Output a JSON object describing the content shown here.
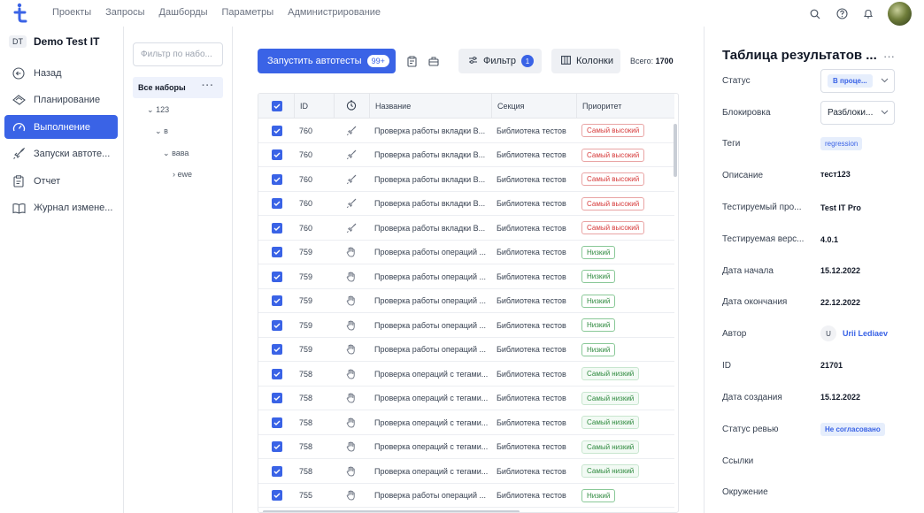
{
  "topnav": [
    "Проекты",
    "Запросы",
    "Дашборды",
    "Параметры",
    "Администрирование"
  ],
  "project": {
    "abbr": "DT",
    "name": "Demo Test IT"
  },
  "sidebar": [
    {
      "label": "Назад",
      "icon": "back-icon"
    },
    {
      "label": "Планирование",
      "icon": "planning-icon"
    },
    {
      "label": "Выполнение",
      "icon": "speedometer-icon",
      "active": true
    },
    {
      "label": "Запуски автоте...",
      "icon": "rocket-icon"
    },
    {
      "label": "Отчет",
      "icon": "report-icon"
    },
    {
      "label": "Журнал измене...",
      "icon": "book-icon"
    }
  ],
  "tree": {
    "filter_placeholder": "Фильтр по набо...",
    "all": "Все наборы",
    "nodes": [
      "123",
      "в",
      "вава",
      "ewe"
    ]
  },
  "toolbar": {
    "run_label": "Запустить автотесты",
    "run_badge": "99+",
    "filter_label": "Фильтр",
    "filter_count": "1",
    "columns_label": "Колонки",
    "total_label": "Всего:",
    "total_value": "1700"
  },
  "table": {
    "headers": {
      "id": "ID",
      "name": "Название",
      "section": "Секция",
      "priority": "Приоритет"
    },
    "rows": [
      {
        "id": "760",
        "type": "auto",
        "name": "Проверка работы вкладки В...",
        "section": "Библиотека тестов",
        "priority": "Самый высокий",
        "level": "high"
      },
      {
        "id": "760",
        "type": "auto",
        "name": "Проверка работы вкладки В...",
        "section": "Библиотека тестов",
        "priority": "Самый высокий",
        "level": "high"
      },
      {
        "id": "760",
        "type": "auto",
        "name": "Проверка работы вкладки В...",
        "section": "Библиотека тестов",
        "priority": "Самый высокий",
        "level": "high"
      },
      {
        "id": "760",
        "type": "auto",
        "name": "Проверка работы вкладки В...",
        "section": "Библиотека тестов",
        "priority": "Самый высокий",
        "level": "high"
      },
      {
        "id": "760",
        "type": "auto",
        "name": "Проверка работы вкладки В...",
        "section": "Библиотека тестов",
        "priority": "Самый высокий",
        "level": "high"
      },
      {
        "id": "759",
        "type": "manual",
        "name": "Проверка работы операций ...",
        "section": "Библиотека тестов",
        "priority": "Низкий",
        "level": "low"
      },
      {
        "id": "759",
        "type": "manual",
        "name": "Проверка работы операций ...",
        "section": "Библиотека тестов",
        "priority": "Низкий",
        "level": "low"
      },
      {
        "id": "759",
        "type": "manual",
        "name": "Проверка работы операций ...",
        "section": "Библиотека тестов",
        "priority": "Низкий",
        "level": "low"
      },
      {
        "id": "759",
        "type": "manual",
        "name": "Проверка работы операций ...",
        "section": "Библиотека тестов",
        "priority": "Низкий",
        "level": "low"
      },
      {
        "id": "759",
        "type": "manual",
        "name": "Проверка работы операций ...",
        "section": "Библиотека тестов",
        "priority": "Низкий",
        "level": "low"
      },
      {
        "id": "758",
        "type": "manual",
        "name": "Проверка операций с тегами...",
        "section": "Библиотека тестов",
        "priority": "Самый низкий",
        "level": "lowest"
      },
      {
        "id": "758",
        "type": "manual",
        "name": "Проверка операций с тегами...",
        "section": "Библиотека тестов",
        "priority": "Самый низкий",
        "level": "lowest"
      },
      {
        "id": "758",
        "type": "manual",
        "name": "Проверка операций с тегами...",
        "section": "Библиотека тестов",
        "priority": "Самый низкий",
        "level": "lowest"
      },
      {
        "id": "758",
        "type": "manual",
        "name": "Проверка операций с тегами...",
        "section": "Библиотека тестов",
        "priority": "Самый низкий",
        "level": "lowest"
      },
      {
        "id": "758",
        "type": "manual",
        "name": "Проверка операций с тегами...",
        "section": "Библиотека тестов",
        "priority": "Самый низкий",
        "level": "lowest"
      },
      {
        "id": "755",
        "type": "manual",
        "name": "Проверка работы операций ...",
        "section": "Библиотека тестов",
        "priority": "Низкий",
        "level": "low"
      }
    ]
  },
  "details": {
    "title": "Таблица результатов ...",
    "status_label": "Статус",
    "status_value": "В проце...",
    "lock_label": "Блокировка",
    "lock_value": "Разблоки...",
    "tags_label": "Теги",
    "tag": "regression",
    "description_label": "Описание",
    "description_value": "тест123",
    "product_label": "Тестируемый про...",
    "product_value": "Test IT Pro",
    "version_label": "Тестируемая верс...",
    "version_value": "4.0.1",
    "start_label": "Дата начала",
    "start_value": "15.12.2022",
    "end_label": "Дата окончания",
    "end_value": "22.12.2022",
    "author_label": "Автор",
    "author_initial": "U",
    "author_name": "Urii Lediaev",
    "id_label": "ID",
    "id_value": "21701",
    "created_label": "Дата создания",
    "created_value": "15.12.2022",
    "review_label": "Статус ревью",
    "review_value": "Не согласовано",
    "links_label": "Ссылки",
    "env_label": "Окружение"
  },
  "colors": {
    "accent": "#3a63e6",
    "high": "#d63b3b",
    "low": "#2f8a3f"
  }
}
